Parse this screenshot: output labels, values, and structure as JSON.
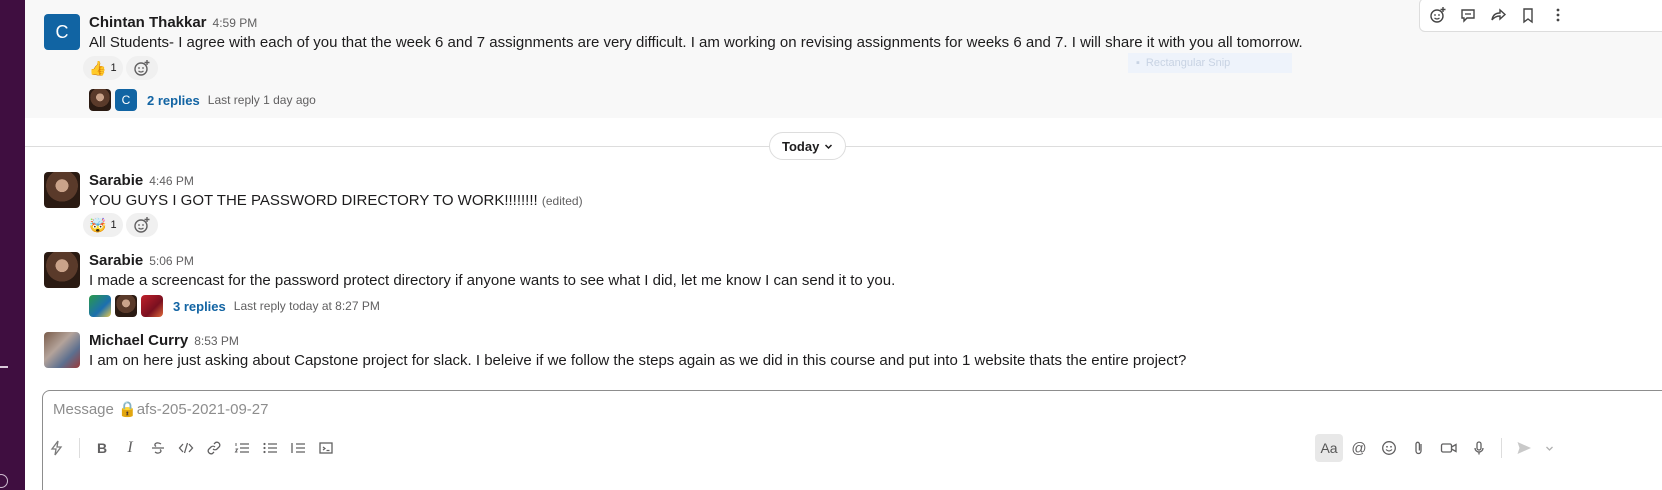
{
  "messages": [
    {
      "sender": "Chintan Thakkar",
      "avatar_letter": "C",
      "time": "4:59 PM",
      "text": "All Students- I agree with each of you that the week 6 and 7 assignments are very difficult.  I am working on revising assignments for weeks 6 and 7. I will share it with you all tomorrow.",
      "reaction": {
        "emoji": "👍",
        "count": "1"
      },
      "thread": {
        "mini_avatar_letter": "C",
        "replies": "2 replies",
        "last_reply": "Last reply 1 day ago"
      }
    },
    {
      "sender": "Sarabie",
      "time": "4:46 PM",
      "text": "YOU GUYS I GOT THE PASSWORD DIRECTORY TO WORK!!!!!!!!",
      "edited": "(edited)",
      "reaction": {
        "emoji": "🤯",
        "count": "1"
      }
    },
    {
      "sender": "Sarabie",
      "time": "5:06 PM",
      "text": "I made a screencast for the password protect directory if anyone wants to see what I did, let me know I can send it to you.",
      "thread": {
        "replies": "3 replies",
        "last_reply": "Last reply today at 8:27 PM"
      }
    },
    {
      "sender": "Michael Curry",
      "time": "8:53 PM",
      "text": "I am on here just asking about Capstone project for slack. I beleive if we follow the steps again as we did in this course and put into 1 website thats the entire project?"
    }
  ],
  "divider": {
    "label": "Today"
  },
  "ghost_label": "Rectangular Snip",
  "composer": {
    "placeholder": "Message 🔒afs-205-2021-09-27"
  },
  "format_icons": [
    "lightning-icon",
    "bold-icon",
    "italic-icon",
    "strike-icon",
    "code-icon",
    "link-icon",
    "ordered-list-icon",
    "bullet-list-icon",
    "block-list-icon",
    "code-block-icon"
  ],
  "format_labels": {
    "bold": "B",
    "italic": "I",
    "aa": "Aa",
    "mention": "@"
  },
  "colors": {
    "sidebar": "#3f0e40",
    "link": "#1264a3",
    "avatar_blue": "#1164a3"
  }
}
